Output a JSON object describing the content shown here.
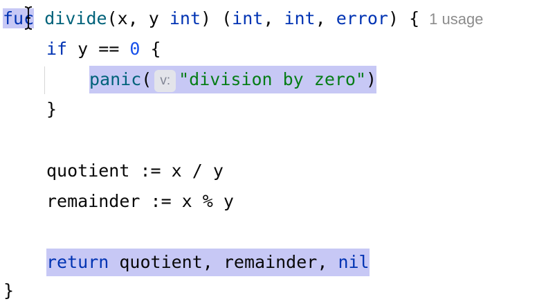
{
  "editor": {
    "lines": {
      "l1": {
        "kw_func_a": "fu",
        "kw_func_b": "c",
        "fn_name": "divide",
        "params": "(x, y ",
        "kw_int1": "int",
        "close": ") (",
        "kw_int2": "int",
        "comma1": ", ",
        "kw_int3": "int",
        "comma2": ", ",
        "kw_error": "error",
        "tail": ") {",
        "usage_hint": "1 usage"
      },
      "l2": {
        "kw_if": "if",
        "cond": " y == ",
        "zero": "0",
        "brace": " {"
      },
      "l3": {
        "fn_panic": "panic",
        "paren_open": "(",
        "param_hint": "v:",
        "message": "\"division by zero\"",
        "paren_close": ")"
      },
      "l4": {
        "brace": "}"
      },
      "l6": {
        "code": "quotient := x / y"
      },
      "l7": {
        "code": "remainder := x % y"
      },
      "l9": {
        "kw_return": "return",
        "values": " quotient, remainder, ",
        "kw_nil": "nil"
      },
      "l10": {
        "brace": "}"
      }
    }
  }
}
